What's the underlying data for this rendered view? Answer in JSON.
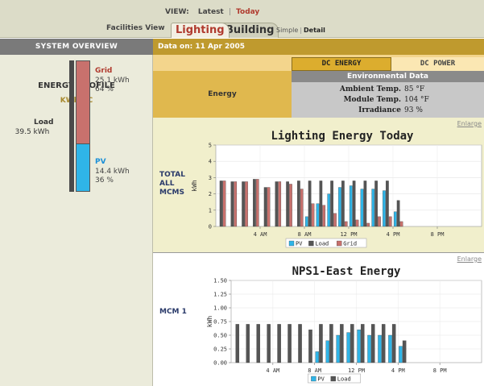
{
  "header": {
    "view_label": "VIEW:",
    "view_latest": "Latest",
    "view_separator": "|",
    "view_today": "Today",
    "facilities_view": "Facilities View",
    "tab_lighting": "Lighting",
    "tab_building": "Building",
    "mode_simple": "Simple",
    "mode_separator": "|",
    "mode_detail": "Detail"
  },
  "left": {
    "section_title": "SYSTEM OVERVIEW",
    "profile_title": "ENERGY PROFILE",
    "profile_unit": "KWh DC",
    "grid": {
      "name": "Grid",
      "kwh": "25.1 kWh",
      "pct": "64 %",
      "share": 0.64
    },
    "pv": {
      "name": "PV",
      "kwh": "14.4 kWh",
      "pct": "36 %",
      "share": 0.36
    },
    "load": {
      "name": "Load",
      "kwh": "39.5 kWh"
    }
  },
  "date_bar": "Data on: 11 Apr 2005",
  "tabs": {
    "dc_energy": "DC ENERGY",
    "dc_power": "DC POWER"
  },
  "energy_label": "Energy",
  "environment": {
    "title": "Environmental Data",
    "rows": [
      {
        "key": "Ambient Temp.",
        "value": "85 °F"
      },
      {
        "key": "Module Temp.",
        "value": "104 °F"
      },
      {
        "key": "Irradiance",
        "value": "93 %"
      }
    ]
  },
  "enlarge_label": "Enlarge",
  "colors": {
    "pv": "#2fb5e8",
    "load": "#555555",
    "grid": "#c8716d",
    "accent": "#b03a2e"
  },
  "chart_data": [
    {
      "type": "bar",
      "title": "Lighting Energy Today",
      "row_label": "TOTAL ALL MCMS",
      "ylabel": "kWh",
      "ylim": [
        0,
        5
      ],
      "yticks": [
        0,
        1,
        2,
        3,
        4,
        5
      ],
      "ytick_labels": [
        "0",
        "1",
        "2",
        "3",
        "4",
        "5"
      ],
      "xlim": [
        0,
        24
      ],
      "xticks": [
        4,
        8,
        12,
        16,
        20
      ],
      "xtick_labels": [
        "4 AM",
        "8 AM",
        "12 PM",
        "4 PM",
        "8 PM"
      ],
      "legend": [
        "PV",
        "Load",
        "Grid"
      ],
      "legend_position": "bottom",
      "x": [
        0,
        1,
        2,
        3,
        4,
        5,
        6,
        7,
        8,
        9,
        10,
        11,
        12,
        13,
        14,
        15,
        16
      ],
      "series": [
        {
          "name": "PV",
          "values": [
            0,
            0,
            0,
            0,
            0,
            0,
            0,
            0,
            0.6,
            1.4,
            2.0,
            2.4,
            2.5,
            2.3,
            2.3,
            2.2,
            0.9
          ]
        },
        {
          "name": "Load",
          "values": [
            2.8,
            2.75,
            2.75,
            2.9,
            2.4,
            2.75,
            2.75,
            2.8,
            2.8,
            2.8,
            2.8,
            2.8,
            2.8,
            2.8,
            2.8,
            2.8,
            1.6
          ]
        },
        {
          "name": "Grid",
          "values": [
            2.8,
            2.75,
            2.75,
            2.9,
            2.4,
            2.75,
            2.6,
            2.3,
            1.4,
            1.3,
            0.8,
            0.3,
            0.4,
            0.2,
            0.6,
            0.6,
            0.3
          ]
        }
      ]
    },
    {
      "type": "bar",
      "title": "NPS1-East Energy",
      "row_label": "MCM 1",
      "ylabel": "kWh",
      "ylim": [
        0,
        1.5
      ],
      "yticks": [
        0,
        0.25,
        0.5,
        0.75,
        1.0,
        1.25,
        1.5
      ],
      "ytick_labels": [
        "0.00",
        "0.25",
        "0.50",
        "0.75",
        "1.00",
        "1.25",
        "1.50"
      ],
      "xlim": [
        0,
        24
      ],
      "xticks": [
        4,
        8,
        12,
        16,
        20
      ],
      "xtick_labels": [
        "4 AM",
        "8 AM",
        "12 PM",
        "4 PM",
        "8 PM"
      ],
      "legend": [
        "PV",
        "Load"
      ],
      "legend_position": "bottom",
      "x": [
        0,
        1,
        2,
        3,
        4,
        5,
        6,
        7,
        8,
        9,
        10,
        11,
        12,
        13,
        14,
        15,
        16
      ],
      "series": [
        {
          "name": "PV",
          "values": [
            0,
            0,
            0,
            0,
            0,
            0,
            0,
            0,
            0.2,
            0.4,
            0.5,
            0.55,
            0.6,
            0.5,
            0.5,
            0.5,
            0.3
          ]
        },
        {
          "name": "Load",
          "values": [
            0.7,
            0.7,
            0.7,
            0.7,
            0.7,
            0.7,
            0.7,
            0.6,
            0.7,
            0.7,
            0.7,
            0.7,
            0.7,
            0.7,
            0.7,
            0.7,
            0.4
          ]
        }
      ]
    }
  ]
}
